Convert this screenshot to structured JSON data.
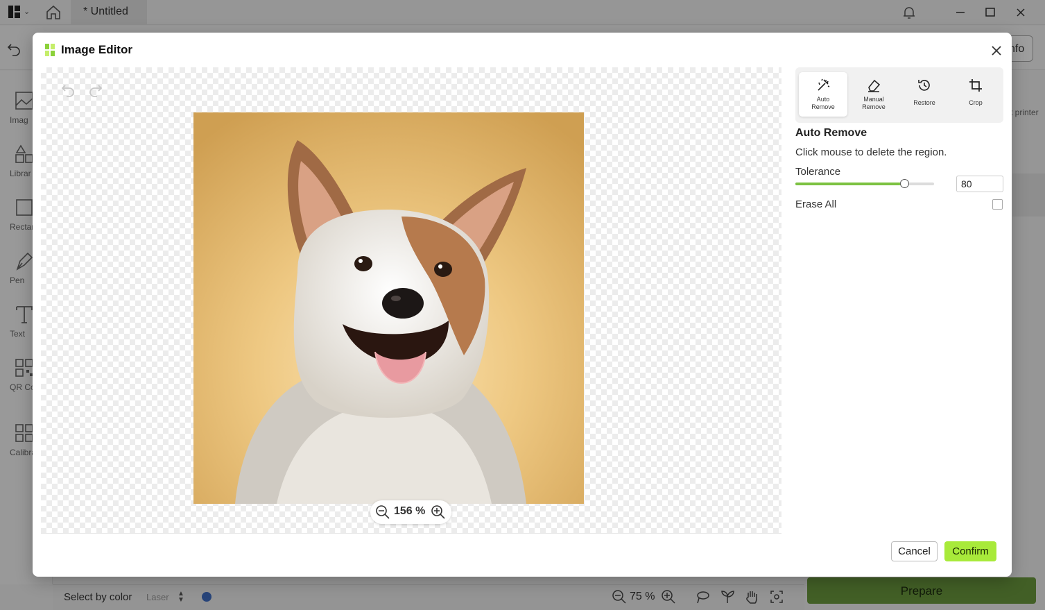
{
  "app": {
    "tab_title": "* Untitled",
    "info_label": "nfo",
    "printer_label": "t printer",
    "rail_items": [
      {
        "label": "Imag",
        "icon": "image-icon"
      },
      {
        "label": "Librar",
        "icon": "library-icon"
      },
      {
        "label": "Rectan",
        "icon": "rectangle-icon"
      },
      {
        "label": "Pen",
        "icon": "pen-icon"
      },
      {
        "label": "Text",
        "icon": "text-icon"
      },
      {
        "label": "QR Co",
        "icon": "qr-code-icon"
      },
      {
        "label": "Calibrat",
        "icon": "calibrate-icon"
      }
    ],
    "bottom": {
      "select_by_color": "Select by color",
      "laser": "Laser",
      "zoom": "75 %",
      "prepare": "Prepare",
      "dot_color": "#3f6ec3"
    }
  },
  "modal": {
    "title": "Image Editor",
    "zoom_value": "156 %",
    "tools": [
      {
        "label_line1": "Auto",
        "label_line2": "Remove",
        "icon": "magic-wand-icon",
        "active": true
      },
      {
        "label_line1": "Manual",
        "label_line2": "Remove",
        "icon": "eraser-icon",
        "active": false
      },
      {
        "label_line1": "Restore",
        "label_line2": "",
        "icon": "restore-icon",
        "active": false
      },
      {
        "label_line1": "Crop",
        "label_line2": "",
        "icon": "crop-icon",
        "active": false
      }
    ],
    "section_title": "Auto Remove",
    "hint": "Click mouse to delete the region.",
    "tolerance_label": "Tolerance",
    "tolerance_value": "80",
    "tolerance_fraction": 0.8,
    "erase_all_label": "Erase All",
    "erase_all_checked": false,
    "cancel_label": "Cancel",
    "confirm_label": "Confirm",
    "accent_color": "#a8ea3a"
  }
}
